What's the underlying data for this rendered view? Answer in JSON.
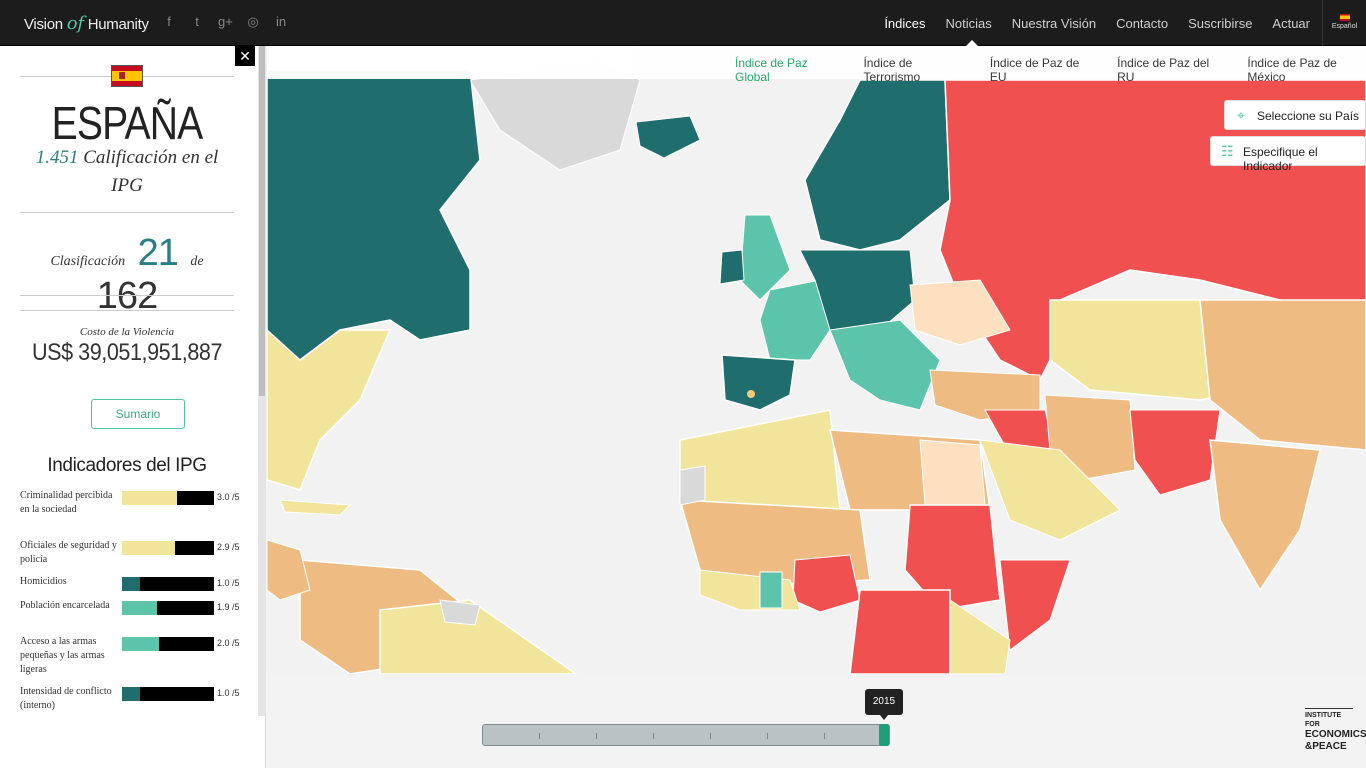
{
  "topbar": {
    "logo_left": "Vision",
    "logo_of": "of",
    "logo_right": "Humanity",
    "social": [
      "f",
      "t",
      "g+",
      "◎",
      "in"
    ],
    "nav": [
      "Índices",
      "Noticias",
      "Nuestra Visión",
      "Contacto",
      "Suscribirse",
      "Actuar"
    ],
    "lang": "Español"
  },
  "subnav": [
    "Índice de Paz Global",
    "Índice de Terrorismo",
    "Índice de Paz de EU",
    "Índice de Paz del RU",
    "Índice de Paz de México"
  ],
  "panel": {
    "close": "✕",
    "country": "ESPAÑA",
    "score": "1.451",
    "score_text": "Calificación en el IPG",
    "rank_label": "Clasificación",
    "rank": "21",
    "of_label": "de",
    "total": "162",
    "cost_label": "Costo de la Violencia",
    "cost_value": "US$ 39,051,951,887",
    "summary_button": "Sumario",
    "indicators_title": "Indicadores del IPG",
    "indicators": [
      {
        "label": "Criminalidad percibida en la sociedad",
        "value": "3.0 /5",
        "level": 0.6,
        "color": "#f1e59b"
      },
      {
        "label": "Oficiales de seguridad y policía",
        "value": "2.9 /5",
        "level": 0.58,
        "color": "#f1e59b"
      },
      {
        "label": "Homicidios",
        "value": "1.0 /5",
        "level": 0.2,
        "color": "#206d6d"
      },
      {
        "label": "Población encarcelada",
        "value": "1.9 /5",
        "level": 0.38,
        "color": "#5cc4aa"
      },
      {
        "label": "Acceso a las armas pequeñas y las armas ligeras",
        "value": "2.0 /5",
        "level": 0.4,
        "color": "#5cc4aa"
      },
      {
        "label": "Intensidad de conflicto (interno)",
        "value": "1.0 /5",
        "level": 0.2,
        "color": "#206d6d"
      }
    ]
  },
  "map": {
    "select_country": "Seleccione su País",
    "specify_indicator": "Especifique el Indicador",
    "colors": {
      "very_high": "#206d6d",
      "high": "#5cc4aa",
      "medium": "#f1e59b",
      "low": "#eebb82",
      "very_low": "#f05050",
      "no_data": "#d9d9d9"
    }
  },
  "timeline": {
    "year": "2015"
  },
  "iep": {
    "line1": "INSTITUTE FOR",
    "line2": "ECONOMICS",
    "line3": "&PEACE"
  }
}
